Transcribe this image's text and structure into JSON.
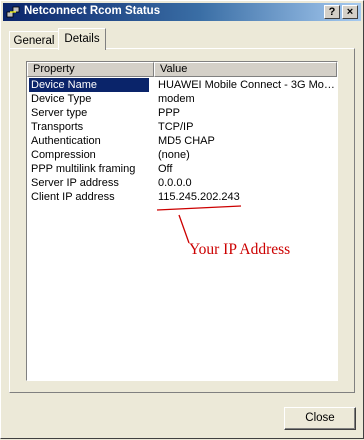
{
  "window": {
    "title": "Netconnect Rcom Status",
    "help_label": "?",
    "close_glyph": "×"
  },
  "tabs": [
    {
      "label": "General",
      "selected": false
    },
    {
      "label": "Details",
      "selected": true
    }
  ],
  "details": {
    "columns": [
      "Property",
      "Value"
    ],
    "rows": [
      {
        "property": "Device Name",
        "value": "HUAWEI Mobile Connect - 3G Mod...",
        "selected": true
      },
      {
        "property": "Device Type",
        "value": "modem"
      },
      {
        "property": "Server type",
        "value": "PPP"
      },
      {
        "property": "Transports",
        "value": "TCP/IP"
      },
      {
        "property": "Authentication",
        "value": "MD5 CHAP"
      },
      {
        "property": "Compression",
        "value": "(none)"
      },
      {
        "property": "PPP multilink framing",
        "value": "Off"
      },
      {
        "property": "Server IP address",
        "value": "0.0.0.0"
      },
      {
        "property": "Client IP address",
        "value": "115.245.202.243"
      }
    ]
  },
  "annotation": {
    "text": "Your IP Address",
    "color": "#cc0000"
  },
  "buttons": {
    "close_label": "Close"
  },
  "colors": {
    "titlebar_start": "#0a246a",
    "titlebar_end": "#a6caf0",
    "selection": "#0a246a",
    "face": "#ece9d8"
  }
}
